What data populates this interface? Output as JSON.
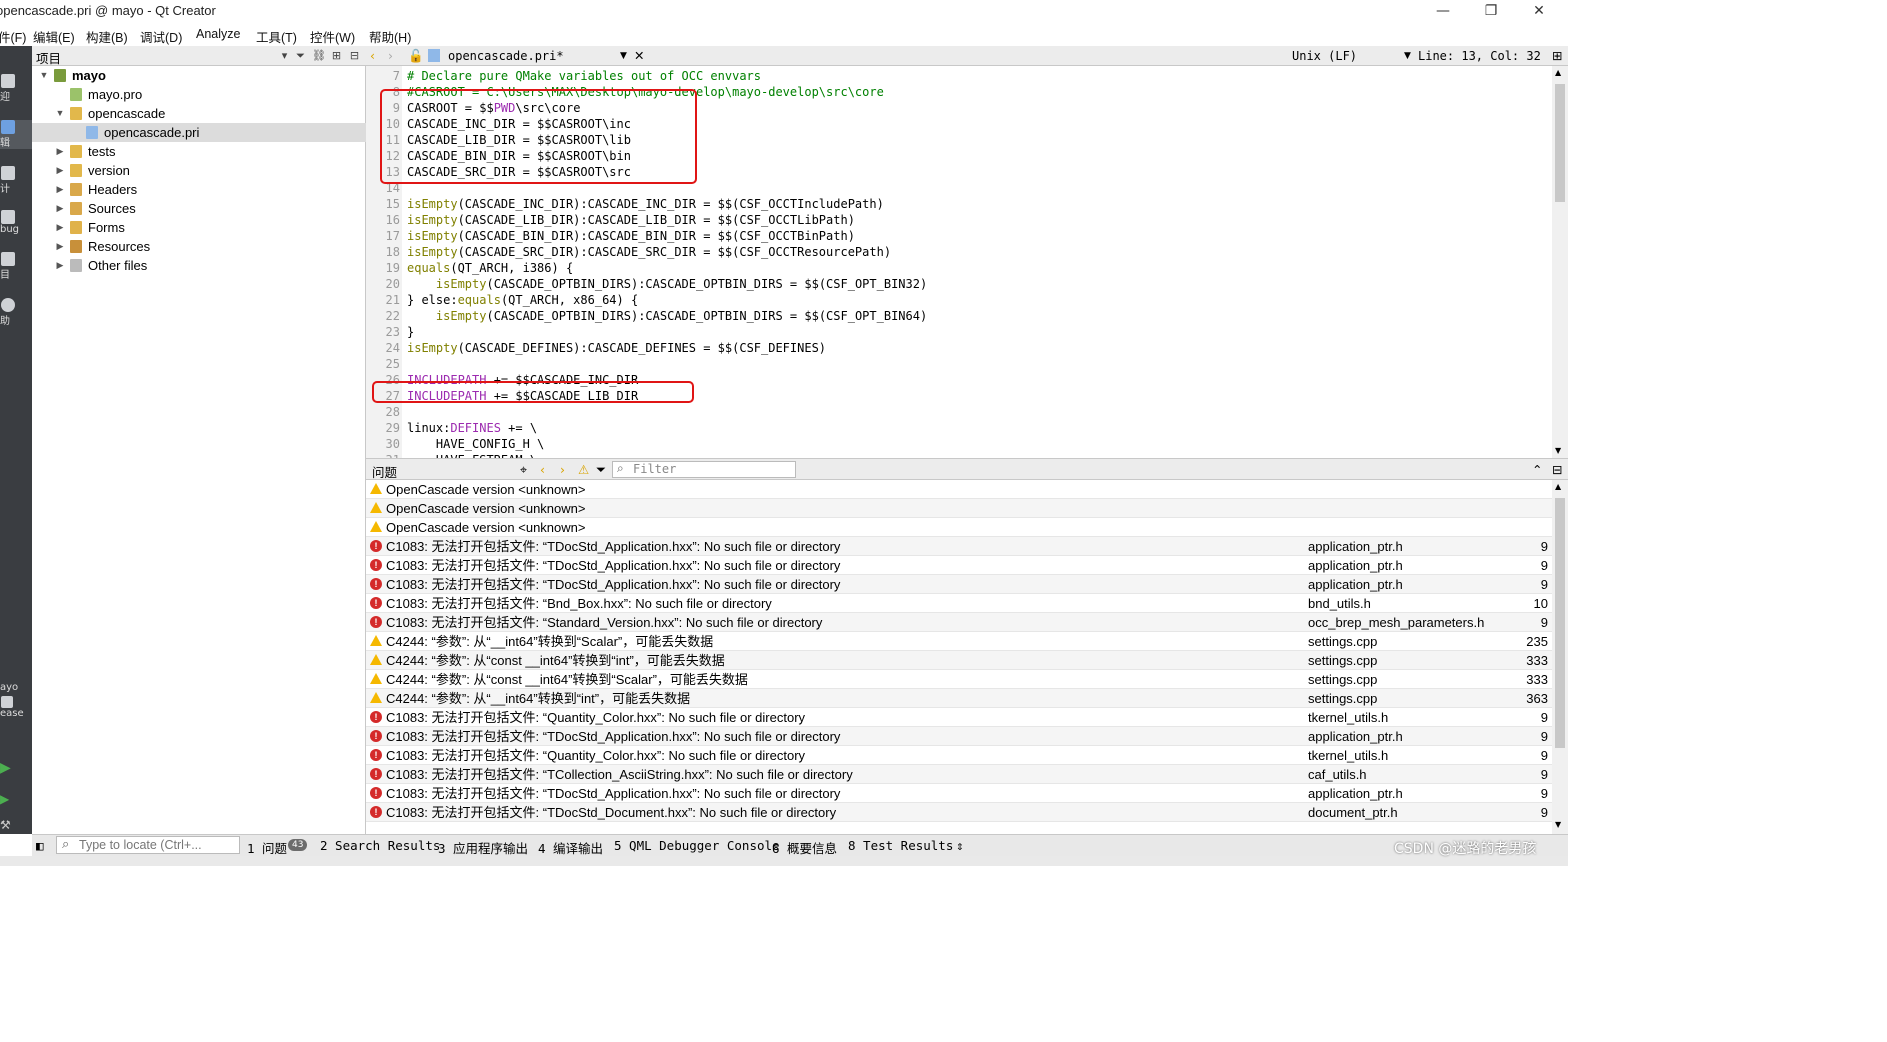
{
  "window": {
    "title": "opencascade.pri @ mayo - Qt Creator",
    "min": "—",
    "restore": "❐",
    "close": "✕"
  },
  "menu": [
    "件(F)",
    "编辑(E)",
    "构建(B)",
    "调试(D)",
    "Analyze",
    "工具(T)",
    "控件(W)",
    "帮助(H)"
  ],
  "modes": [
    {
      "label": "迎"
    },
    {
      "label": "辑"
    },
    {
      "label": "计"
    },
    {
      "label": "bug"
    },
    {
      "label": "目"
    },
    {
      "label": "助"
    }
  ],
  "kit": {
    "project": "ayo",
    "build": "ease"
  },
  "project_panel": {
    "title": "项目"
  },
  "tree": [
    {
      "label": "mayo",
      "level": 0,
      "expanded": true,
      "bold": true,
      "icon": "project-folder-icon"
    },
    {
      "label": "mayo.pro",
      "level": 1,
      "icon": "pro-file-icon"
    },
    {
      "label": "opencascade",
      "level": 1,
      "expanded": true,
      "icon": "folder-icon"
    },
    {
      "label": "opencascade.pri",
      "level": 2,
      "selected": true,
      "icon": "pri-file-icon"
    },
    {
      "label": "tests",
      "level": 1,
      "collapsed": true,
      "icon": "folder-icon"
    },
    {
      "label": "version",
      "level": 1,
      "collapsed": true,
      "icon": "folder-icon"
    },
    {
      "label": "Headers",
      "level": 1,
      "collapsed": true,
      "icon": "headers-folder-icon"
    },
    {
      "label": "Sources",
      "level": 1,
      "collapsed": true,
      "icon": "sources-folder-icon"
    },
    {
      "label": "Forms",
      "level": 1,
      "collapsed": true,
      "icon": "forms-folder-icon"
    },
    {
      "label": "Resources",
      "level": 1,
      "collapsed": true,
      "icon": "resources-folder-icon"
    },
    {
      "label": "Other files",
      "level": 1,
      "collapsed": true,
      "icon": "other-files-icon"
    }
  ],
  "editor_header": {
    "file": "opencascade.pri*",
    "line_ending": "Unix (LF)",
    "position": "Line: 13, Col: 32"
  },
  "code": [
    {
      "n": "7",
      "t": "# Declare pure QMake variables out of OCC envvars",
      "type": "comment"
    },
    {
      "n": "8",
      "t": "#CASROOT = C:\\Users\\MAX\\Desktop\\mayo-develop\\mayo-develop\\src\\core",
      "type": "comment"
    },
    {
      "n": "9",
      "pre": "CASROOT = $$",
      "kw": "PWD",
      "post": "\\src\\core"
    },
    {
      "n": "10",
      "t": "CASCADE_INC_DIR = $$CASROOT\\inc"
    },
    {
      "n": "11",
      "t": "CASCADE_LIB_DIR = $$CASROOT\\lib"
    },
    {
      "n": "12",
      "t": "CASCADE_BIN_DIR = $$CASROOT\\bin"
    },
    {
      "n": "13",
      "t": "CASCADE_SRC_DIR = $$CASROOT\\src"
    },
    {
      "n": "14",
      "t": ""
    },
    {
      "n": "15",
      "indent": "",
      "fn": "isEmpty",
      "post": "(CASCADE_INC_DIR):CASCADE_INC_DIR = $$(CSF_OCCTIncludePath)"
    },
    {
      "n": "16",
      "indent": "",
      "fn": "isEmpty",
      "post": "(CASCADE_LIB_DIR):CASCADE_LIB_DIR = $$(CSF_OCCTLibPath)"
    },
    {
      "n": "17",
      "indent": "",
      "fn": "isEmpty",
      "post": "(CASCADE_BIN_DIR):CASCADE_BIN_DIR = $$(CSF_OCCTBinPath)"
    },
    {
      "n": "18",
      "indent": "",
      "fn": "isEmpty",
      "post": "(CASCADE_SRC_DIR):CASCADE_SRC_DIR = $$(CSF_OCCTResourcePath)"
    },
    {
      "n": "19",
      "indent": "",
      "fn": "equals",
      "post": "(QT_ARCH, i386) {"
    },
    {
      "n": "20",
      "indent": "    ",
      "fn": "isEmpty",
      "post": "(CASCADE_OPTBIN_DIRS):CASCADE_OPTBIN_DIRS = $$(CSF_OPT_BIN32)"
    },
    {
      "n": "21",
      "indent": "} else:",
      "fn": "equals",
      "post": "(QT_ARCH, x86_64) {"
    },
    {
      "n": "22",
      "indent": "    ",
      "fn": "isEmpty",
      "post": "(CASCADE_OPTBIN_DIRS):CASCADE_OPTBIN_DIRS = $$(CSF_OPT_BIN64)"
    },
    {
      "n": "23",
      "t": "}"
    },
    {
      "n": "24",
      "indent": "",
      "fn": "isEmpty",
      "post": "(CASCADE_DEFINES):CASCADE_DEFINES = $$(CSF_DEFINES)"
    },
    {
      "n": "25",
      "t": ""
    },
    {
      "n": "26",
      "pre": "",
      "kw": "INCLUDEPATH",
      "post": " += $$CASCADE_INC_DIR"
    },
    {
      "n": "27",
      "pre": "",
      "kw": "INCLUDEPATH",
      "post": " += $$CASCADE_LIB_DIR"
    },
    {
      "n": "28",
      "t": ""
    },
    {
      "n": "29",
      "pre": "linux:",
      "kw": "DEFINES",
      "post": " += \\"
    },
    {
      "n": "30",
      "t": "    HAVE_CONFIG_H \\"
    },
    {
      "n": "31",
      "t": "    HAVE_FSTREAM \\"
    }
  ],
  "issues_panel": {
    "title": "问题",
    "filter_placeholder": "Filter"
  },
  "issues": [
    {
      "type": "warn",
      "msg": "OpenCascade version <unknown>",
      "file": "",
      "line": ""
    },
    {
      "type": "warn",
      "msg": "OpenCascade version <unknown>",
      "file": "",
      "line": ""
    },
    {
      "type": "warn",
      "msg": "OpenCascade version <unknown>",
      "file": "",
      "line": ""
    },
    {
      "type": "err",
      "msg": "C1083: 无法打开包括文件: “TDocStd_Application.hxx”: No such file or directory",
      "file": "application_ptr.h",
      "line": "9"
    },
    {
      "type": "err",
      "msg": "C1083: 无法打开包括文件: “TDocStd_Application.hxx”: No such file or directory",
      "file": "application_ptr.h",
      "line": "9"
    },
    {
      "type": "err",
      "msg": "C1083: 无法打开包括文件: “TDocStd_Application.hxx”: No such file or directory",
      "file": "application_ptr.h",
      "line": "9"
    },
    {
      "type": "err",
      "msg": "C1083: 无法打开包括文件: “Bnd_Box.hxx”: No such file or directory",
      "file": "bnd_utils.h",
      "line": "10"
    },
    {
      "type": "err",
      "msg": "C1083: 无法打开包括文件: “Standard_Version.hxx”: No such file or directory",
      "file": "occ_brep_mesh_parameters.h",
      "line": "9"
    },
    {
      "type": "warn",
      "msg": "C4244: “参数”: 从“__int64”转换到“Scalar”，可能丢失数据",
      "file": "settings.cpp",
      "line": "235"
    },
    {
      "type": "warn",
      "msg": "C4244: “参数”: 从“const __int64”转换到“int”，可能丢失数据",
      "file": "settings.cpp",
      "line": "333"
    },
    {
      "type": "warn",
      "msg": "C4244: “参数”: 从“const __int64”转换到“Scalar”，可能丢失数据",
      "file": "settings.cpp",
      "line": "333"
    },
    {
      "type": "warn",
      "msg": "C4244: “参数”: 从“__int64”转换到“int”，可能丢失数据",
      "file": "settings.cpp",
      "line": "363"
    },
    {
      "type": "err",
      "msg": "C1083: 无法打开包括文件: “Quantity_Color.hxx”: No such file or directory",
      "file": "tkernel_utils.h",
      "line": "9"
    },
    {
      "type": "err",
      "msg": "C1083: 无法打开包括文件: “TDocStd_Application.hxx”: No such file or directory",
      "file": "application_ptr.h",
      "line": "9"
    },
    {
      "type": "err",
      "msg": "C1083: 无法打开包括文件: “Quantity_Color.hxx”: No such file or directory",
      "file": "tkernel_utils.h",
      "line": "9"
    },
    {
      "type": "err",
      "msg": "C1083: 无法打开包括文件: “TCollection_AsciiString.hxx”: No such file or directory",
      "file": "caf_utils.h",
      "line": "9"
    },
    {
      "type": "err",
      "msg": "C1083: 无法打开包括文件: “TDocStd_Application.hxx”: No such file or directory",
      "file": "application_ptr.h",
      "line": "9"
    },
    {
      "type": "err",
      "msg": "C1083: 无法打开包括文件: “TDocStd_Document.hxx”: No such file or directory",
      "file": "document_ptr.h",
      "line": "9"
    }
  ],
  "statusbar": {
    "locate_placeholder": "Type to locate (Ctrl+...",
    "tabs": [
      "1 问题",
      "2 Search Results",
      "3 应用程序输出",
      "4 编译输出",
      "5 QML Debugger Console",
      "6 概要信息",
      "8 Test Results"
    ],
    "issue_count": "43"
  },
  "watermark": "CSDN @迷路的老男孩"
}
